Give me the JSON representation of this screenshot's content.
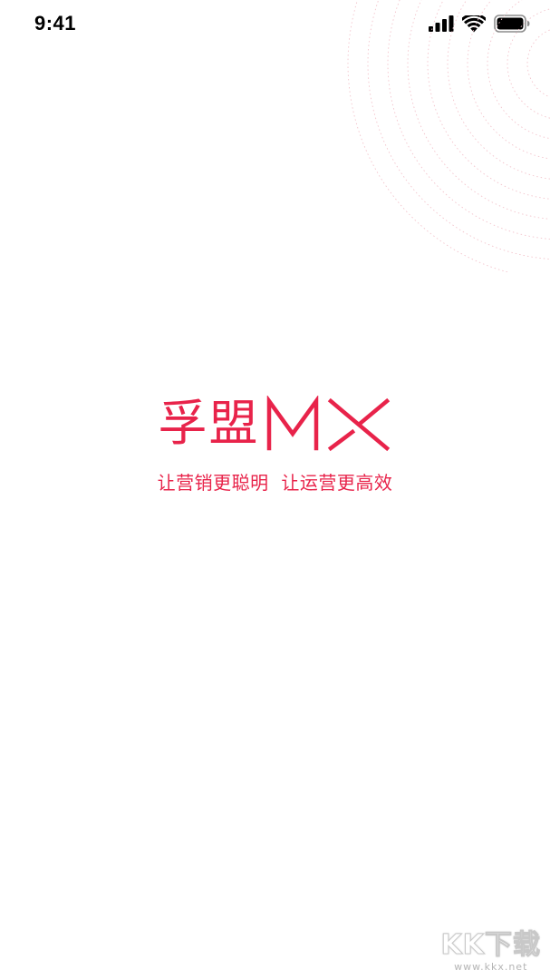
{
  "status_bar": {
    "time": "9:41"
  },
  "splash": {
    "logo_cn": "孚盟",
    "logo_en": "MX",
    "slogan": "让营销更聪明  让运营更高效"
  },
  "watermark": {
    "main": "KK下载",
    "sub": "www.kkx.net"
  },
  "colors": {
    "brand": "#e8234a",
    "background": "#ffffff",
    "decoration": "#f3c4cc"
  },
  "icons": [
    "cellular-signal-icon",
    "wifi-icon",
    "battery-icon"
  ]
}
